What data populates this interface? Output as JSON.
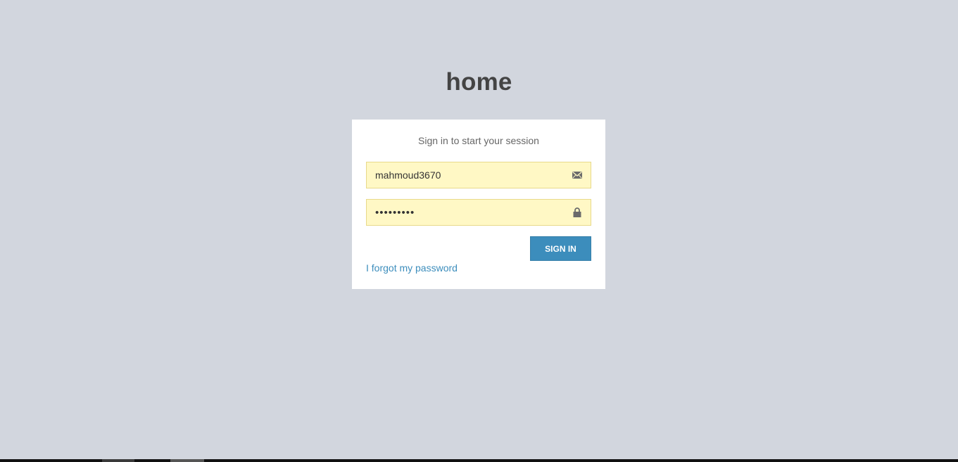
{
  "logo": {
    "text": "home"
  },
  "login": {
    "message": "Sign in to start your session",
    "username": {
      "value": "mahmoud3670",
      "icon": "envelope-icon"
    },
    "password": {
      "value": "•••••••••",
      "icon": "lock-icon"
    },
    "signin_label": "SIGN IN",
    "forgot_label": "I forgot my password"
  },
  "colors": {
    "background": "#d2d6de",
    "box": "#ffffff",
    "autofill": "#fff8c5",
    "primary": "#3c8dbc",
    "heading": "#444444"
  }
}
